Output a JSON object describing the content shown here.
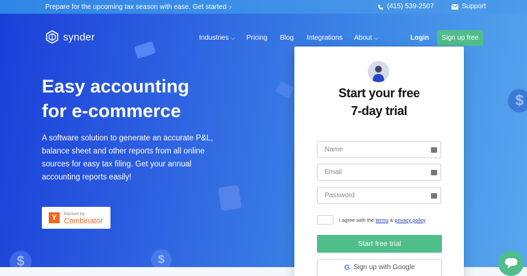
{
  "topbar": {
    "announcement": "Prepare for the upcoming tax season with ease. Get started",
    "chevron": "›",
    "phone": "(415) 539-2507",
    "support": "Support"
  },
  "nav": {
    "logo": "synder",
    "items": [
      {
        "label": "Industries",
        "caret": "⌵"
      },
      {
        "label": "Pricing"
      },
      {
        "label": "Blog"
      },
      {
        "label": "Integrations"
      },
      {
        "label": "About",
        "caret": "⌵"
      }
    ],
    "login": "Login",
    "signup": "Sign up free"
  },
  "hero": {
    "title_line1": "Easy accounting",
    "title_line2": "for e-commerce",
    "description": "A software solution to generate an accurate P&L, balance sheet and other reports from all online sources for easy tax filing. Get your annual accounting reports easily!",
    "badge_small": "Backed by",
    "badge_big": "Combinator",
    "badge_logo": "Y"
  },
  "form": {
    "title_line1": "Start your free",
    "title_line2": "7-day trial",
    "name_placeholder": "Name",
    "email_placeholder": "Email",
    "password_placeholder": "Password",
    "agree_prefix": "I agree with the ",
    "terms": "terms",
    "amp": " & ",
    "privacy": "privacy policy",
    "submit": "Start free trial",
    "google": "Sign up with Google",
    "google_glyph": "G"
  },
  "decor": {
    "dollar": "$"
  },
  "colors": {
    "accent_green": "#4fbe8b",
    "hero_blue": "#1a3fd8",
    "link_blue": "#1f3fae"
  }
}
